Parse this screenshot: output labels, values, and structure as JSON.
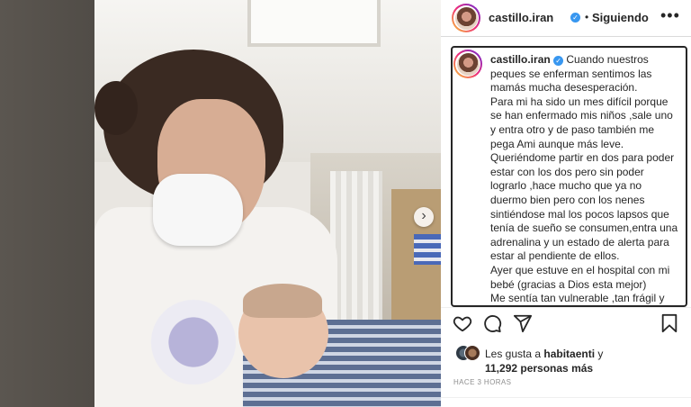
{
  "post": {
    "username": "castillo.iran",
    "dot": "•",
    "follow_label": "Siguiendo",
    "more_label": "•••",
    "next_label": "›",
    "caption_user": "castillo.iran",
    "caption": "Cuando nuestros peques se enferman sentimos las mamás mucha desesperación.\nPara mi ha sido un mes difícil porque se han enfermado mis niños ,sale uno y entra otro y de paso también me pega Ami aunque más leve.\nQueriéndome partir en dos para poder estar con los dos pero sin poder lograrlo ,hace mucho que ya no duermo bien pero con los nenes sintiéndose mal los pocos lapsos que tenía de sueño se consumen,entra una adrenalina y un estado de alerta para estar al pendiente de ellos.\nAyer que estuve en el hospital con mi bebé (gracias a Dios esta mejor)\nMe sentía tan vulnerable ,tan frágil y con muchas ganas de llorar",
    "likes_prefix": "Les gusta a ",
    "likes_user": "habitaenti",
    "likes_suffix": " y",
    "likes_count": "11,292 personas más",
    "timestamp": "HACE 3 HORAS",
    "verified_mark": "✓"
  },
  "icons": {
    "like": "heart-icon",
    "comment": "comment-icon",
    "share": "share-icon",
    "save": "bookmark-icon"
  },
  "colors": {
    "verified": "#3897f0",
    "text": "#262626",
    "muted": "#8e8e8e"
  }
}
